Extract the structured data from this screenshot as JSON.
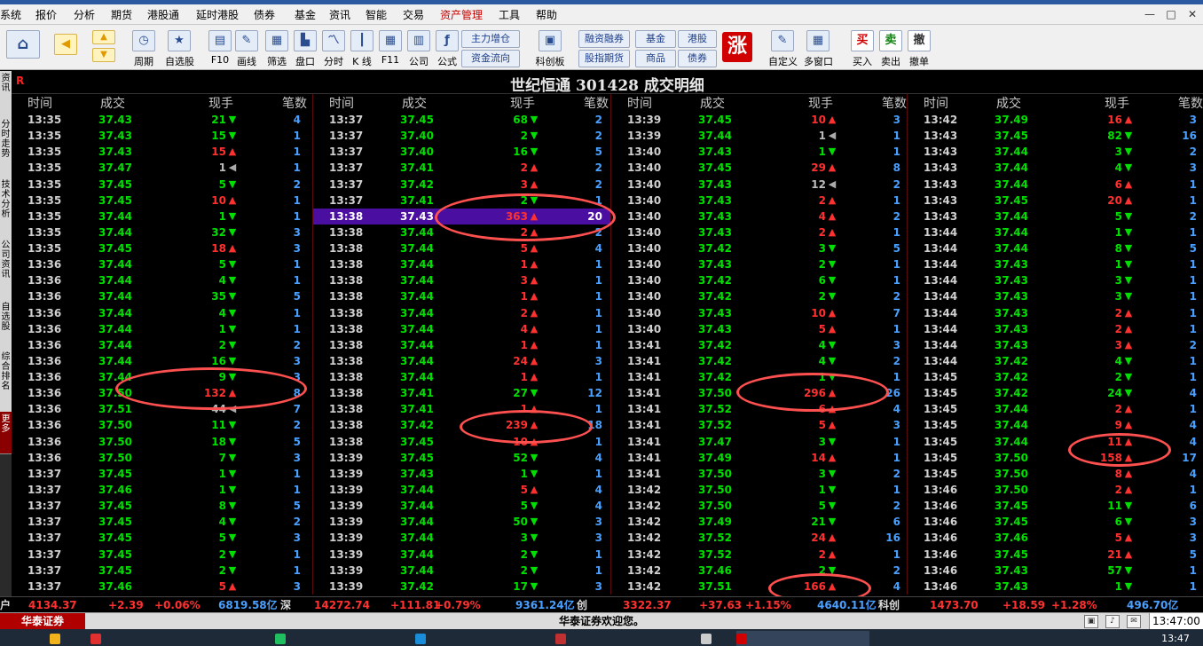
{
  "menu": [
    "系统",
    "报价",
    "分析",
    "期货",
    "港股通",
    "延时港股",
    "债券",
    "基金",
    "资讯",
    "智能",
    "交易",
    "资产管理",
    "工具",
    "帮助"
  ],
  "menu_active": "资产管理",
  "window_controls": [
    "—",
    "□",
    "✕"
  ],
  "toolbar": {
    "items": [
      {
        "label": "周期",
        "icon": "clock-icon",
        "glyph": "◷"
      },
      {
        "label": "自选股",
        "icon": "star-icon",
        "glyph": "★"
      },
      {
        "label": "F10",
        "icon": "doc-icon",
        "glyph": "▤"
      },
      {
        "label": "画线",
        "icon": "pen-icon",
        "glyph": "✎"
      },
      {
        "label": "筛选",
        "icon": "filter-icon",
        "glyph": "▦"
      },
      {
        "label": "盘口",
        "icon": "chart-icon",
        "glyph": "▙"
      },
      {
        "label": "分时",
        "icon": "line-icon",
        "glyph": "〽"
      },
      {
        "label": "K 线",
        "icon": "candle-icon",
        "glyph": "┃"
      },
      {
        "label": "F11",
        "icon": "grid-icon",
        "glyph": "▦"
      },
      {
        "label": "公司",
        "icon": "building-icon",
        "glyph": "▥"
      },
      {
        "label": "公式",
        "icon": "formula-icon",
        "glyph": "ƒ"
      }
    ],
    "buttons_a": [
      "主力增仓",
      "资金流向"
    ],
    "kechuang": "科创板",
    "buttons_b": [
      "融资融券",
      "股指期货",
      "基金",
      "商品",
      "港股",
      "债券"
    ],
    "zhang": "涨",
    "items_right": [
      {
        "label": "自定义",
        "icon": "custom-icon",
        "glyph": "✎"
      },
      {
        "label": "多窗口",
        "icon": "windows-icon",
        "glyph": "▦"
      },
      {
        "label": "买入",
        "icon": "buy-icon",
        "glyph": "买"
      },
      {
        "label": "卖出",
        "icon": "sell-icon",
        "glyph": "卖"
      },
      {
        "label": "撤单",
        "icon": "cancel-icon",
        "glyph": "撤"
      }
    ]
  },
  "side_tabs": [
    "资讯",
    "分时走势",
    "技术分析",
    "公司资讯",
    "自选股",
    "综合排名",
    "更多"
  ],
  "title": "世纪恒通 301428 成交明细",
  "title_mark": "R",
  "headers": [
    "时间",
    "成交",
    "现手",
    "笔数"
  ],
  "columns": [
    [
      [
        "13:35",
        "37.43",
        "21",
        "d",
        "4"
      ],
      [
        "13:35",
        "37.43",
        "15",
        "d",
        "1"
      ],
      [
        "13:35",
        "37.43",
        "15",
        "u",
        "1"
      ],
      [
        "13:35",
        "37.47",
        "1",
        "f",
        "1"
      ],
      [
        "13:35",
        "37.45",
        "5",
        "d",
        "2"
      ],
      [
        "13:35",
        "37.45",
        "10",
        "u",
        "1"
      ],
      [
        "13:35",
        "37.44",
        "1",
        "d",
        "1"
      ],
      [
        "13:35",
        "37.44",
        "32",
        "d",
        "3"
      ],
      [
        "13:35",
        "37.45",
        "18",
        "u",
        "3"
      ],
      [
        "13:36",
        "37.44",
        "5",
        "d",
        "1"
      ],
      [
        "13:36",
        "37.44",
        "4",
        "d",
        "1"
      ],
      [
        "13:36",
        "37.44",
        "35",
        "d",
        "5"
      ],
      [
        "13:36",
        "37.44",
        "4",
        "d",
        "1"
      ],
      [
        "13:36",
        "37.44",
        "1",
        "d",
        "1"
      ],
      [
        "13:36",
        "37.44",
        "2",
        "d",
        "2"
      ],
      [
        "13:36",
        "37.44",
        "16",
        "d",
        "3"
      ],
      [
        "13:36",
        "37.44",
        "9",
        "d",
        "3"
      ],
      [
        "13:36",
        "37.50",
        "132",
        "u",
        "8"
      ],
      [
        "13:36",
        "37.51",
        "44",
        "f",
        "7"
      ],
      [
        "13:36",
        "37.50",
        "11",
        "d",
        "2"
      ],
      [
        "13:36",
        "37.50",
        "18",
        "d",
        "5"
      ],
      [
        "13:36",
        "37.50",
        "7",
        "d",
        "3"
      ],
      [
        "13:37",
        "37.45",
        "1",
        "d",
        "1"
      ],
      [
        "13:37",
        "37.46",
        "1",
        "d",
        "1"
      ],
      [
        "13:37",
        "37.45",
        "8",
        "d",
        "5"
      ],
      [
        "13:37",
        "37.45",
        "4",
        "d",
        "2"
      ],
      [
        "13:37",
        "37.45",
        "5",
        "d",
        "3"
      ],
      [
        "13:37",
        "37.45",
        "2",
        "d",
        "1"
      ],
      [
        "13:37",
        "37.45",
        "2",
        "d",
        "1"
      ],
      [
        "13:37",
        "37.46",
        "5",
        "u",
        "3"
      ]
    ],
    [
      [
        "13:37",
        "37.45",
        "68",
        "d",
        "2"
      ],
      [
        "13:37",
        "37.40",
        "2",
        "d",
        "2"
      ],
      [
        "13:37",
        "37.40",
        "16",
        "d",
        "5"
      ],
      [
        "13:37",
        "37.41",
        "2",
        "u",
        "2"
      ],
      [
        "13:37",
        "37.42",
        "3",
        "u",
        "2"
      ],
      [
        "13:37",
        "37.41",
        "2",
        "d",
        "1"
      ],
      [
        "13:38",
        "37.43",
        "363",
        "u",
        "20"
      ],
      [
        "13:38",
        "37.44",
        "2",
        "u",
        "2"
      ],
      [
        "13:38",
        "37.44",
        "5",
        "u",
        "4"
      ],
      [
        "13:38",
        "37.44",
        "1",
        "u",
        "1"
      ],
      [
        "13:38",
        "37.44",
        "3",
        "u",
        "1"
      ],
      [
        "13:38",
        "37.44",
        "1",
        "u",
        "1"
      ],
      [
        "13:38",
        "37.44",
        "2",
        "u",
        "1"
      ],
      [
        "13:38",
        "37.44",
        "4",
        "u",
        "1"
      ],
      [
        "13:38",
        "37.44",
        "1",
        "u",
        "1"
      ],
      [
        "13:38",
        "37.44",
        "24",
        "u",
        "3"
      ],
      [
        "13:38",
        "37.44",
        "1",
        "u",
        "1"
      ],
      [
        "13:38",
        "37.41",
        "27",
        "d",
        "12"
      ],
      [
        "13:38",
        "37.41",
        "1",
        "u",
        "1"
      ],
      [
        "13:38",
        "37.42",
        "239",
        "u",
        "18"
      ],
      [
        "13:38",
        "37.45",
        "10",
        "u",
        "1"
      ],
      [
        "13:39",
        "37.45",
        "52",
        "d",
        "4"
      ],
      [
        "13:39",
        "37.43",
        "1",
        "d",
        "1"
      ],
      [
        "13:39",
        "37.44",
        "5",
        "u",
        "4"
      ],
      [
        "13:39",
        "37.44",
        "5",
        "d",
        "4"
      ],
      [
        "13:39",
        "37.44",
        "50",
        "d",
        "3"
      ],
      [
        "13:39",
        "37.44",
        "3",
        "d",
        "3"
      ],
      [
        "13:39",
        "37.44",
        "2",
        "d",
        "1"
      ],
      [
        "13:39",
        "37.44",
        "2",
        "d",
        "1"
      ],
      [
        "13:39",
        "37.42",
        "17",
        "d",
        "3"
      ]
    ],
    [
      [
        "13:39",
        "37.45",
        "10",
        "u",
        "3"
      ],
      [
        "13:39",
        "37.44",
        "1",
        "f",
        "1"
      ],
      [
        "13:40",
        "37.43",
        "1",
        "d",
        "1"
      ],
      [
        "13:40",
        "37.45",
        "29",
        "u",
        "8"
      ],
      [
        "13:40",
        "37.43",
        "12",
        "f",
        "2"
      ],
      [
        "13:40",
        "37.43",
        "2",
        "u",
        "1"
      ],
      [
        "13:40",
        "37.43",
        "4",
        "u",
        "2"
      ],
      [
        "13:40",
        "37.43",
        "2",
        "u",
        "1"
      ],
      [
        "13:40",
        "37.42",
        "3",
        "d",
        "5"
      ],
      [
        "13:40",
        "37.43",
        "2",
        "d",
        "1"
      ],
      [
        "13:40",
        "37.42",
        "6",
        "d",
        "1"
      ],
      [
        "13:40",
        "37.42",
        "2",
        "d",
        "2"
      ],
      [
        "13:40",
        "37.43",
        "10",
        "u",
        "7"
      ],
      [
        "13:40",
        "37.43",
        "5",
        "u",
        "1"
      ],
      [
        "13:41",
        "37.42",
        "4",
        "d",
        "3"
      ],
      [
        "13:41",
        "37.42",
        "4",
        "d",
        "2"
      ],
      [
        "13:41",
        "37.42",
        "1",
        "d",
        "1"
      ],
      [
        "13:41",
        "37.50",
        "296",
        "u",
        "26"
      ],
      [
        "13:41",
        "37.52",
        "6",
        "u",
        "4"
      ],
      [
        "13:41",
        "37.52",
        "5",
        "u",
        "3"
      ],
      [
        "13:41",
        "37.47",
        "3",
        "d",
        "1"
      ],
      [
        "13:41",
        "37.49",
        "14",
        "u",
        "1"
      ],
      [
        "13:41",
        "37.50",
        "3",
        "d",
        "2"
      ],
      [
        "13:42",
        "37.50",
        "1",
        "d",
        "1"
      ],
      [
        "13:42",
        "37.50",
        "5",
        "d",
        "2"
      ],
      [
        "13:42",
        "37.49",
        "21",
        "d",
        "6"
      ],
      [
        "13:42",
        "37.52",
        "24",
        "u",
        "16"
      ],
      [
        "13:42",
        "37.52",
        "2",
        "u",
        "1"
      ],
      [
        "13:42",
        "37.46",
        "2",
        "d",
        "2"
      ],
      [
        "13:42",
        "37.51",
        "166",
        "u",
        "4"
      ]
    ],
    [
      [
        "13:42",
        "37.49",
        "16",
        "u",
        "3"
      ],
      [
        "13:43",
        "37.45",
        "82",
        "d",
        "16"
      ],
      [
        "13:43",
        "37.44",
        "3",
        "d",
        "2"
      ],
      [
        "13:43",
        "37.44",
        "4",
        "d",
        "3"
      ],
      [
        "13:43",
        "37.44",
        "6",
        "u",
        "1"
      ],
      [
        "13:43",
        "37.45",
        "20",
        "u",
        "1"
      ],
      [
        "13:43",
        "37.44",
        "5",
        "d",
        "2"
      ],
      [
        "13:44",
        "37.44",
        "1",
        "d",
        "1"
      ],
      [
        "13:44",
        "37.44",
        "8",
        "d",
        "5"
      ],
      [
        "13:44",
        "37.43",
        "1",
        "d",
        "1"
      ],
      [
        "13:44",
        "37.43",
        "3",
        "d",
        "1"
      ],
      [
        "13:44",
        "37.43",
        "3",
        "d",
        "1"
      ],
      [
        "13:44",
        "37.43",
        "2",
        "u",
        "1"
      ],
      [
        "13:44",
        "37.43",
        "2",
        "u",
        "1"
      ],
      [
        "13:44",
        "37.43",
        "3",
        "u",
        "2"
      ],
      [
        "13:44",
        "37.42",
        "4",
        "d",
        "1"
      ],
      [
        "13:45",
        "37.42",
        "2",
        "d",
        "1"
      ],
      [
        "13:45",
        "37.42",
        "24",
        "d",
        "4"
      ],
      [
        "13:45",
        "37.44",
        "2",
        "u",
        "1"
      ],
      [
        "13:45",
        "37.44",
        "9",
        "u",
        "4"
      ],
      [
        "13:45",
        "37.44",
        "11",
        "u",
        "4"
      ],
      [
        "13:45",
        "37.50",
        "158",
        "u",
        "17"
      ],
      [
        "13:45",
        "37.50",
        "8",
        "u",
        "4"
      ],
      [
        "13:46",
        "37.50",
        "2",
        "u",
        "1"
      ],
      [
        "13:46",
        "37.45",
        "11",
        "d",
        "6"
      ],
      [
        "13:46",
        "37.45",
        "6",
        "d",
        "3"
      ],
      [
        "13:46",
        "37.46",
        "5",
        "u",
        "3"
      ],
      [
        "13:46",
        "37.45",
        "21",
        "u",
        "5"
      ],
      [
        "13:46",
        "37.43",
        "57",
        "d",
        "1"
      ],
      [
        "13:46",
        "37.43",
        "1",
        "d",
        "1"
      ]
    ]
  ],
  "highlight_row": {
    "column": 1,
    "row": 6
  },
  "index_bar": [
    {
      "text": "户",
      "color": "white"
    },
    {
      "text": "4134.37",
      "color": "red"
    },
    {
      "text": "+2.39",
      "color": "red"
    },
    {
      "text": "+0.06%",
      "color": "red"
    },
    {
      "text": "6819.58亿",
      "color": "blue"
    },
    {
      "text": "深",
      "color": "white"
    },
    {
      "text": "14272.74",
      "color": "red"
    },
    {
      "text": "+111.81",
      "color": "red"
    },
    {
      "text": "+0.79%",
      "color": "red"
    },
    {
      "text": "9361.24亿",
      "color": "blue"
    },
    {
      "text": "创",
      "color": "white"
    },
    {
      "text": "3322.37",
      "color": "red"
    },
    {
      "text": "+37.63",
      "color": "red"
    },
    {
      "text": "+1.15%",
      "color": "red"
    },
    {
      "text": "4640.11亿",
      "color": "blue"
    },
    {
      "text": "科创",
      "color": "white"
    },
    {
      "text": "1473.70",
      "color": "red"
    },
    {
      "text": "+18.59",
      "color": "red"
    },
    {
      "text": "+1.28%",
      "color": "red"
    },
    {
      "text": "496.70亿",
      "color": "blue"
    }
  ],
  "status": {
    "brand": "华泰证券",
    "welcome": "华泰证券欢迎您。",
    "time": "13:47:00"
  },
  "taskbar": {
    "clock": "13:47"
  }
}
